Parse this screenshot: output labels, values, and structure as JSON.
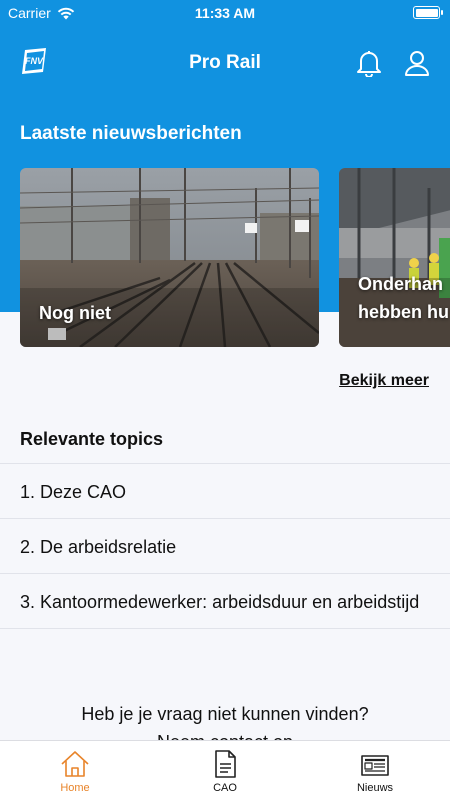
{
  "status_bar": {
    "carrier": "Carrier",
    "time": "11:33 AM"
  },
  "header": {
    "title": "Pro Rail",
    "logo_text": "FNV"
  },
  "news": {
    "title": "Laatste nieuwsberichten",
    "items": [
      {
        "caption": "Nog niet"
      },
      {
        "caption_line1": "Onderhan",
        "caption_line2": "hebben hu"
      }
    ],
    "more_label": "Bekijk meer"
  },
  "topics": {
    "title": "Relevante topics",
    "items": [
      {
        "label": "1. Deze CAO"
      },
      {
        "label": "2. De arbeidsrelatie"
      },
      {
        "label": "3. Kantoormedewerker: arbeidsduur en arbeidstijd"
      }
    ]
  },
  "help": {
    "line1": "Heb je je vraag niet kunnen vinden?",
    "line2": "Neem contact op"
  },
  "tabbar": {
    "tabs": [
      {
        "label": "Home",
        "icon": "home-icon",
        "active": true
      },
      {
        "label": "CAO",
        "icon": "document-icon",
        "active": false
      },
      {
        "label": "Nieuws",
        "icon": "newspaper-icon",
        "active": false
      }
    ]
  },
  "colors": {
    "brand_blue": "#1192e0",
    "active_tab": "#e8842a",
    "background": "#f6f7fb"
  }
}
